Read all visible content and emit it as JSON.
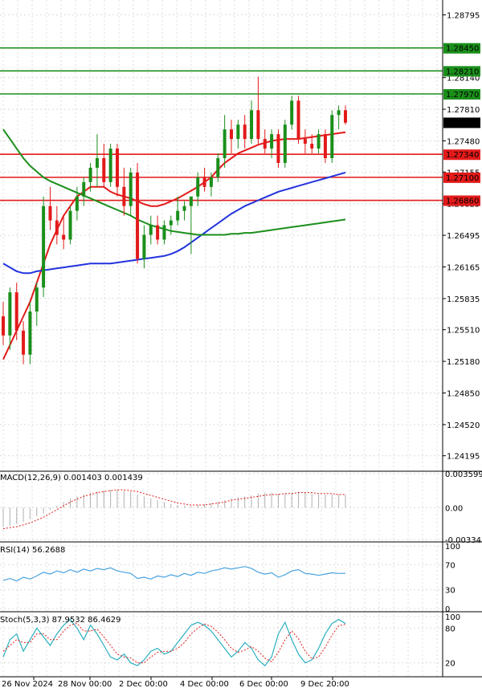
{
  "chart_data": {
    "type": "line",
    "price_axis": {
      "ticks": [
        "1.28795",
        "1.28140",
        "1.27810",
        "1.27480",
        "1.27155",
        "1.26825",
        "1.26495",
        "1.26165",
        "1.25835",
        "1.25510",
        "1.25180",
        "1.24850",
        "1.24520",
        "1.24195"
      ],
      "ylim": [
        1.2405,
        1.2895
      ]
    },
    "x_ticks": [
      "26 Nov 2024",
      "28 Nov 00:00",
      "2 Dec 00:00",
      "4 Dec 00:00",
      "6 Dec 00:00",
      "9 Dec 20:00"
    ],
    "current_price": "1.27673",
    "horizontal_levels": [
      {
        "value": 1.2845,
        "label": "1.28450",
        "color": "#1b8f1b"
      },
      {
        "value": 1.2821,
        "label": "1.28210",
        "color": "#1b8f1b"
      },
      {
        "value": 1.2797,
        "label": "1.27970",
        "color": "#1b8f1b"
      },
      {
        "value": 1.2734,
        "label": "1.27340",
        "color": "#e31a1a"
      },
      {
        "value": 1.271,
        "label": "1.27100",
        "color": "#e31a1a"
      },
      {
        "value": 1.2686,
        "label": "1.26860",
        "color": "#e31a1a"
      }
    ],
    "candles": [
      [
        1.2565,
        1.258,
        1.2535,
        1.2545
      ],
      [
        1.2545,
        1.2595,
        1.253,
        1.259
      ],
      [
        1.259,
        1.26,
        1.254,
        1.255
      ],
      [
        1.255,
        1.256,
        1.2515,
        1.2525
      ],
      [
        1.2525,
        1.258,
        1.2515,
        1.257
      ],
      [
        1.257,
        1.26,
        1.2555,
        1.2595
      ],
      [
        1.2595,
        1.269,
        1.2585,
        1.268
      ],
      [
        1.268,
        1.27,
        1.2655,
        1.2665
      ],
      [
        1.2665,
        1.268,
        1.264,
        1.265
      ],
      [
        1.265,
        1.267,
        1.2635,
        1.2645
      ],
      [
        1.2645,
        1.268,
        1.264,
        1.2675
      ],
      [
        1.2675,
        1.27,
        1.2665,
        1.269
      ],
      [
        1.269,
        1.271,
        1.268,
        1.2705
      ],
      [
        1.2705,
        1.2725,
        1.2695,
        1.272
      ],
      [
        1.272,
        1.2755,
        1.27,
        1.273
      ],
      [
        1.273,
        1.2745,
        1.27,
        1.2705
      ],
      [
        1.2705,
        1.2745,
        1.27,
        1.274
      ],
      [
        1.274,
        1.2745,
        1.269,
        1.27
      ],
      [
        1.27,
        1.272,
        1.267,
        1.268
      ],
      [
        1.268,
        1.272,
        1.267,
        1.2715
      ],
      [
        1.2715,
        1.2725,
        1.262,
        1.2625
      ],
      [
        1.2625,
        1.266,
        1.2615,
        1.265
      ],
      [
        1.265,
        1.267,
        1.264,
        1.266
      ],
      [
        1.266,
        1.267,
        1.264,
        1.2645
      ],
      [
        1.2645,
        1.2665,
        1.264,
        1.266
      ],
      [
        1.266,
        1.267,
        1.265,
        1.2665
      ],
      [
        1.2665,
        1.269,
        1.266,
        1.2675
      ],
      [
        1.2675,
        1.2685,
        1.2665,
        1.268
      ],
      [
        1.268,
        1.2685,
        1.263,
        1.269
      ],
      [
        1.269,
        1.2715,
        1.268,
        1.271
      ],
      [
        1.271,
        1.272,
        1.2695,
        1.27
      ],
      [
        1.27,
        1.2715,
        1.269,
        1.271
      ],
      [
        1.271,
        1.2735,
        1.2705,
        1.273
      ],
      [
        1.273,
        1.2775,
        1.272,
        1.276
      ],
      [
        1.276,
        1.277,
        1.2735,
        1.275
      ],
      [
        1.275,
        1.277,
        1.274,
        1.2765
      ],
      [
        1.2765,
        1.2775,
        1.274,
        1.275
      ],
      [
        1.275,
        1.279,
        1.2745,
        1.278
      ],
      [
        1.278,
        1.2815,
        1.2745,
        1.275
      ],
      [
        1.275,
        1.276,
        1.2735,
        1.274
      ],
      [
        1.274,
        1.276,
        1.273,
        1.2755
      ],
      [
        1.2755,
        1.276,
        1.272,
        1.2725
      ],
      [
        1.2725,
        1.277,
        1.272,
        1.2765
      ],
      [
        1.2765,
        1.2795,
        1.276,
        1.279
      ],
      [
        1.279,
        1.2795,
        1.2745,
        1.275
      ],
      [
        1.275,
        1.276,
        1.2735,
        1.2745
      ],
      [
        1.2745,
        1.2755,
        1.2735,
        1.274
      ],
      [
        1.274,
        1.276,
        1.2735,
        1.2755
      ],
      [
        1.2755,
        1.276,
        1.2725,
        1.273
      ],
      [
        1.273,
        1.278,
        1.2725,
        1.2775
      ],
      [
        1.2775,
        1.2785,
        1.276,
        1.278
      ],
      [
        1.278,
        1.2785,
        1.2765,
        1.2767
      ]
    ],
    "series": [
      {
        "name": "",
        "color": "#e31a1a",
        "values": [
          1.252,
          1.2535,
          1.255,
          1.2565,
          1.258,
          1.26,
          1.262,
          1.264,
          1.2655,
          1.267,
          1.268,
          1.269,
          1.2695,
          1.27,
          1.27,
          1.27,
          1.2695,
          1.2692,
          1.269,
          1.2688,
          1.2685,
          1.2682,
          1.268,
          1.268,
          1.2682,
          1.2685,
          1.2688,
          1.2692,
          1.2696,
          1.27,
          1.2705,
          1.271,
          1.2718,
          1.2725,
          1.273,
          1.2735,
          1.2738,
          1.2741,
          1.2744,
          1.2746,
          1.2748,
          1.2749,
          1.275,
          1.275,
          1.275,
          1.2751,
          1.2752,
          1.2753,
          1.2754,
          1.2755,
          1.2756,
          1.2757
        ]
      },
      {
        "name": "",
        "color": "#2233dd",
        "values": [
          1.262,
          1.2616,
          1.2612,
          1.261,
          1.261,
          1.2612,
          1.2613,
          1.2614,
          1.2615,
          1.2616,
          1.2617,
          1.2618,
          1.2619,
          1.262,
          1.262,
          1.262,
          1.262,
          1.2621,
          1.2622,
          1.2623,
          1.2624,
          1.2625,
          1.2626,
          1.2627,
          1.2628,
          1.263,
          1.2633,
          1.2637,
          1.2642,
          1.2647,
          1.2652,
          1.2657,
          1.2662,
          1.2667,
          1.2672,
          1.2676,
          1.268,
          1.2683,
          1.2686,
          1.2689,
          1.2692,
          1.2695,
          1.2697,
          1.2699,
          1.2701,
          1.2703,
          1.2705,
          1.2707,
          1.2709,
          1.2711,
          1.2713,
          1.2715
        ]
      },
      {
        "name": "",
        "color": "#1b8f1b",
        "values": [
          1.276,
          1.275,
          1.274,
          1.273,
          1.2722,
          1.2716,
          1.271,
          1.2706,
          1.2703,
          1.27,
          1.2697,
          1.2694,
          1.2691,
          1.2688,
          1.2685,
          1.2682,
          1.2679,
          1.2676,
          1.2673,
          1.267,
          1.2666,
          1.2663,
          1.266,
          1.2658,
          1.2656,
          1.2654,
          1.2653,
          1.2652,
          1.2651,
          1.265,
          1.265,
          1.265,
          1.265,
          1.265,
          1.2651,
          1.2651,
          1.2652,
          1.2652,
          1.2653,
          1.2654,
          1.2655,
          1.2656,
          1.2657,
          1.2658,
          1.2659,
          1.266,
          1.2661,
          1.2662,
          1.2663,
          1.2664,
          1.2665,
          1.2666
        ]
      }
    ],
    "macd": {
      "label": "MACD(12,26,9) 0.001403 0.001439",
      "ticks": [
        "0.003599",
        "0.00",
        "-0.003345"
      ],
      "ylim": [
        -0.003345,
        0.003599
      ],
      "histogram": [
        -0.002,
        -0.0019,
        -0.0017,
        -0.0015,
        -0.0012,
        -0.0009,
        -0.0006,
        -0.0002,
        0.0002,
        0.0006,
        0.001,
        0.0012,
        0.0014,
        0.0016,
        0.0017,
        0.0018,
        0.0019,
        0.0019,
        0.0018,
        0.0017,
        0.0014,
        0.0012,
        0.001,
        0.0008,
        0.0006,
        0.0004,
        0.0003,
        0.0002,
        0.0002,
        0.0003,
        0.0004,
        0.0005,
        0.0006,
        0.0008,
        0.001,
        0.0011,
        0.0012,
        0.0013,
        0.0015,
        0.0016,
        0.0016,
        0.0015,
        0.0015,
        0.0016,
        0.0017,
        0.0016,
        0.0015,
        0.0014,
        0.0014,
        0.0014,
        0.0014,
        0.0014
      ],
      "signal": [
        -0.0022,
        -0.0021,
        -0.002,
        -0.0018,
        -0.0016,
        -0.0013,
        -0.001,
        -0.0006,
        -0.0002,
        0.0002,
        0.0006,
        0.0009,
        0.0012,
        0.0014,
        0.0016,
        0.0017,
        0.0018,
        0.0019,
        0.0019,
        0.0018,
        0.0017,
        0.0015,
        0.0013,
        0.0011,
        0.0009,
        0.0007,
        0.0005,
        0.0004,
        0.0003,
        0.0003,
        0.0003,
        0.0004,
        0.0005,
        0.0006,
        0.0008,
        0.0009,
        0.001,
        0.0011,
        0.0012,
        0.0013,
        0.0014,
        0.0014,
        0.0015,
        0.0015,
        0.0016,
        0.0016,
        0.0016,
        0.0015,
        0.0015,
        0.0015,
        0.0014,
        0.0014
      ]
    },
    "rsi": {
      "label": "RSI(14) 56.2688",
      "ticks": [
        "100",
        "70",
        "30",
        "0"
      ],
      "ylim": [
        0,
        100
      ],
      "values": [
        45,
        48,
        44,
        50,
        47,
        52,
        58,
        55,
        60,
        57,
        62,
        58,
        63,
        60,
        64,
        62,
        65,
        60,
        58,
        56,
        48,
        50,
        47,
        52,
        50,
        54,
        51,
        56,
        53,
        58,
        56,
        60,
        62,
        65,
        63,
        65,
        67,
        64,
        58,
        55,
        57,
        50,
        54,
        60,
        62,
        56,
        55,
        53,
        55,
        57,
        56,
        56.27
      ]
    },
    "stoch": {
      "label": "Stoch(5,3,3) 87.9532 86.4629",
      "ticks": [
        "100",
        "80",
        "20"
      ],
      "ylim": [
        0,
        100
      ],
      "k": [
        30,
        60,
        70,
        40,
        60,
        80,
        65,
        50,
        70,
        85,
        95,
        80,
        60,
        85,
        70,
        50,
        30,
        25,
        35,
        20,
        15,
        25,
        40,
        45,
        35,
        40,
        55,
        70,
        85,
        90,
        85,
        75,
        60,
        45,
        30,
        40,
        55,
        45,
        25,
        15,
        30,
        70,
        90,
        60,
        35,
        20,
        25,
        45,
        70,
        88,
        95,
        87.95
      ],
      "d": [
        40,
        50,
        60,
        55,
        55,
        70,
        70,
        60,
        60,
        75,
        85,
        88,
        75,
        75,
        78,
        65,
        50,
        35,
        30,
        28,
        20,
        20,
        30,
        38,
        40,
        40,
        45,
        55,
        70,
        80,
        87,
        83,
        73,
        60,
        45,
        38,
        42,
        48,
        40,
        28,
        22,
        38,
        60,
        75,
        62,
        40,
        27,
        30,
        47,
        68,
        84,
        86.46
      ]
    }
  }
}
